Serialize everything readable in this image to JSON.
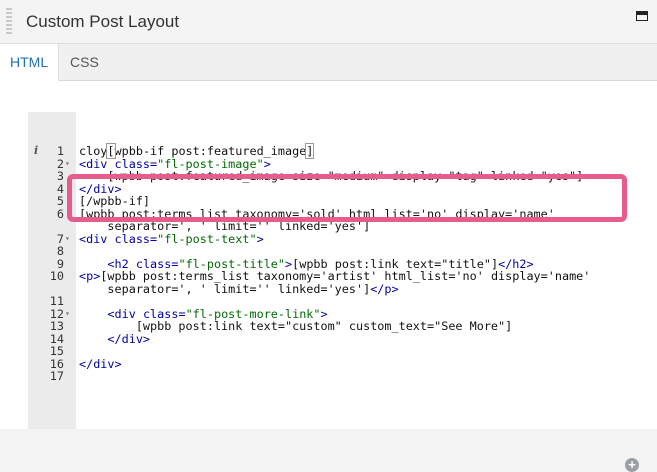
{
  "header": {
    "title": "Custom Post Layout"
  },
  "tabs": [
    {
      "label": "HTML",
      "active": true
    },
    {
      "label": "CSS",
      "active": false
    }
  ],
  "editor": {
    "lines": [
      {
        "num": "1",
        "info": "i",
        "fold": "",
        "segments": [
          {
            "text": "cloy",
            "cls": ""
          },
          {
            "text": "[",
            "cls": "cursor-box"
          },
          {
            "text": "wpbb-if post:featured_image",
            "cls": ""
          },
          {
            "text": "]",
            "cls": "cursor-box"
          }
        ]
      },
      {
        "num": "2",
        "fold": "▾",
        "segments": [
          {
            "text": "<div ",
            "cls": "t"
          },
          {
            "text": "class=",
            "cls": "t"
          },
          {
            "text": "\"fl-post-image\"",
            "cls": "s"
          },
          {
            "text": ">",
            "cls": "t"
          }
        ]
      },
      {
        "num": "3",
        "fold": "",
        "segments": [
          {
            "text": "    [wpbb post:featured_image size=\"medium\" display=\"tag\" linked=\"yes\"]",
            "cls": ""
          }
        ]
      },
      {
        "num": "4",
        "fold": "",
        "segments": [
          {
            "text": "</div>",
            "cls": "t"
          }
        ]
      },
      {
        "num": "5",
        "fold": "",
        "segments": [
          {
            "text": "[/wpbb-if]",
            "cls": ""
          }
        ]
      },
      {
        "num": "6",
        "fold": "",
        "segments": [
          {
            "text": "[wpbb post:terms_list taxonomy='sold' html_list='no' display='name'",
            "cls": ""
          }
        ]
      },
      {
        "num": "",
        "fold": "",
        "segments": [
          {
            "text": "    separator=', ' limit='' linked='yes']",
            "cls": ""
          }
        ]
      },
      {
        "num": "7",
        "fold": "▾",
        "segments": [
          {
            "text": "<div ",
            "cls": "t"
          },
          {
            "text": "class=",
            "cls": "t"
          },
          {
            "text": "\"fl-post-text\"",
            "cls": "s"
          },
          {
            "text": ">",
            "cls": "t"
          }
        ]
      },
      {
        "num": "8",
        "fold": "",
        "segments": [
          {
            "text": "",
            "cls": ""
          }
        ]
      },
      {
        "num": "9",
        "fold": "",
        "segments": [
          {
            "text": "    ",
            "cls": ""
          },
          {
            "text": "<h2 ",
            "cls": "t"
          },
          {
            "text": "class=",
            "cls": "t"
          },
          {
            "text": "\"fl-post-title\"",
            "cls": "s"
          },
          {
            "text": ">",
            "cls": "t"
          },
          {
            "text": "[wpbb post:link text=\"title\"]",
            "cls": ""
          },
          {
            "text": "</h2>",
            "cls": "t"
          }
        ]
      },
      {
        "num": "10",
        "fold": "",
        "segments": [
          {
            "text": "<p>",
            "cls": "t"
          },
          {
            "text": "[wpbb post:terms_list taxonomy='artist' html_list='no' display='name'",
            "cls": ""
          }
        ]
      },
      {
        "num": "",
        "fold": "",
        "segments": [
          {
            "text": "    separator=', ' limit='' linked='yes']",
            "cls": ""
          },
          {
            "text": "</p>",
            "cls": "t"
          }
        ]
      },
      {
        "num": "11",
        "fold": "",
        "segments": [
          {
            "text": "",
            "cls": ""
          }
        ]
      },
      {
        "num": "12",
        "fold": "▾",
        "segments": [
          {
            "text": "    ",
            "cls": ""
          },
          {
            "text": "<div ",
            "cls": "t"
          },
          {
            "text": "class=",
            "cls": "t"
          },
          {
            "text": "\"fl-post-more-link\"",
            "cls": "s"
          },
          {
            "text": ">",
            "cls": "t"
          }
        ]
      },
      {
        "num": "13",
        "fold": "",
        "segments": [
          {
            "text": "        [wpbb post:link text=\"custom\" custom_text=\"See More\"]",
            "cls": ""
          }
        ]
      },
      {
        "num": "14",
        "fold": "",
        "segments": [
          {
            "text": "    ",
            "cls": ""
          },
          {
            "text": "</div>",
            "cls": "t"
          }
        ]
      },
      {
        "num": "15",
        "fold": "",
        "segments": [
          {
            "text": "",
            "cls": ""
          }
        ]
      },
      {
        "num": "16",
        "fold": "",
        "segments": [
          {
            "text": "</div>",
            "cls": "t"
          }
        ]
      },
      {
        "num": "17",
        "fold": "",
        "segments": [
          {
            "text": "",
            "cls": ""
          }
        ]
      }
    ]
  },
  "add_icon": "plus-circle-icon",
  "colors": {
    "highlight": "#e85c8a",
    "tab_active": "#2271b1",
    "tag": "#0000a2",
    "string": "#036a07"
  }
}
